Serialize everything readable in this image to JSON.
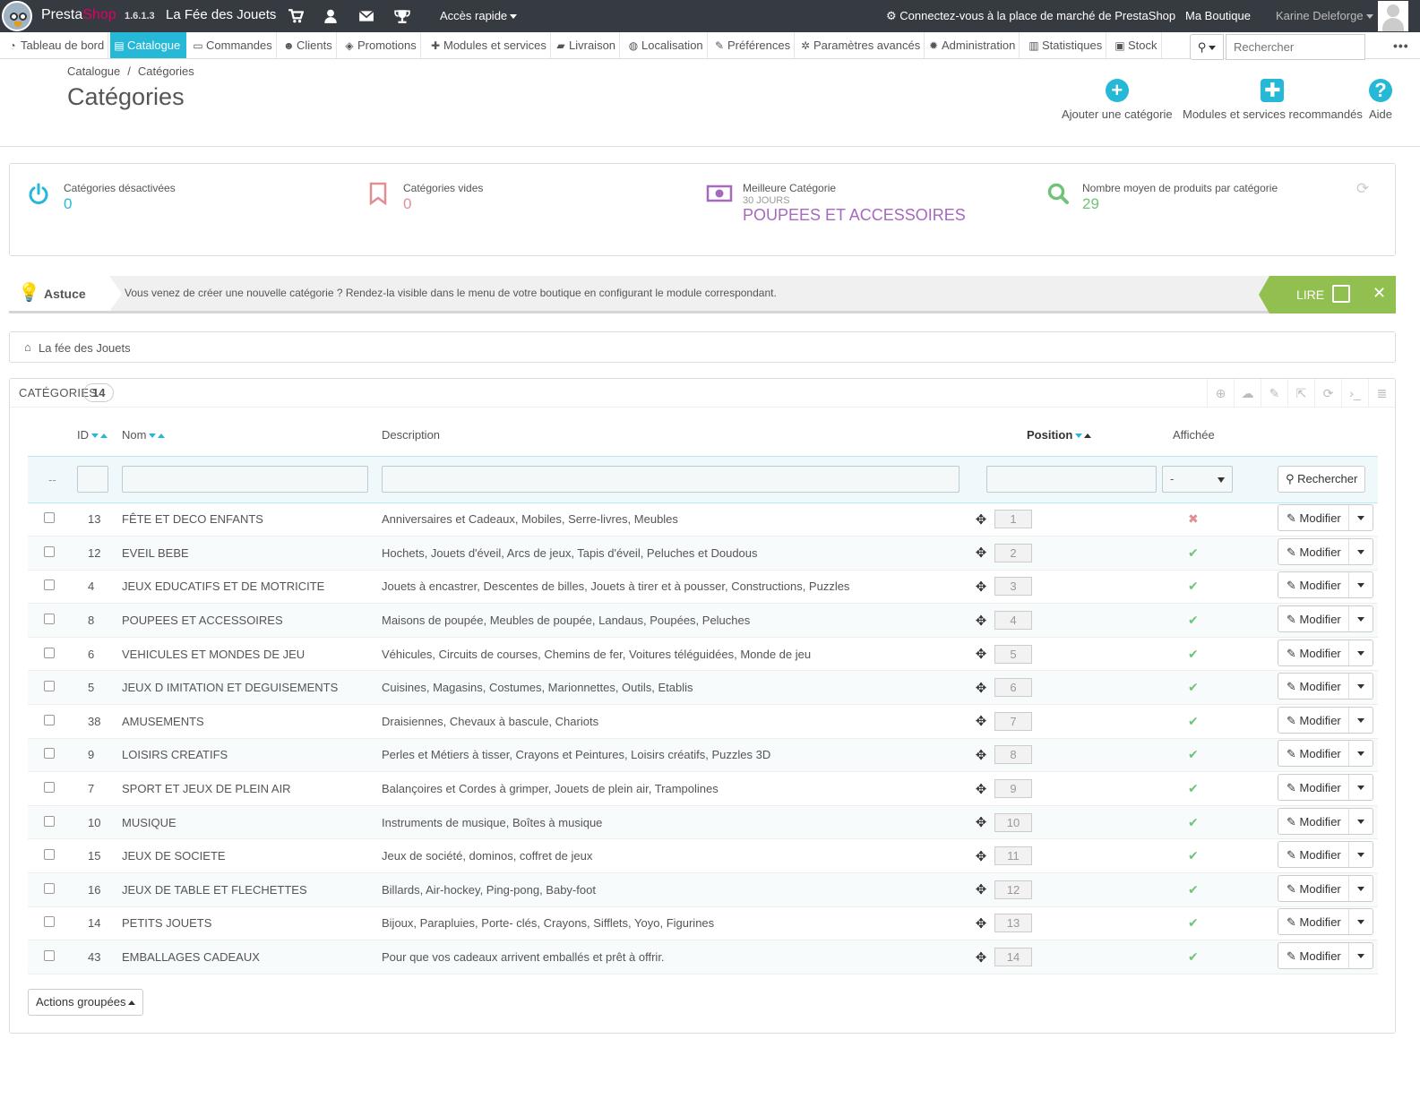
{
  "topbar": {
    "brand_part1": "Presta",
    "brand_part2": "Shop",
    "version": "1.6.1.3",
    "shop_name": "La Fée des Jouets",
    "quick_access": "Accès rapide",
    "marketplace": "Connectez-vous à la place de marché de PrestaShop",
    "my_shop": "Ma Boutique",
    "user": "Karine Deleforge"
  },
  "nav": {
    "items": [
      {
        "label": "Tableau de bord",
        "icon": "dashboard-icon"
      },
      {
        "label": "Catalogue",
        "icon": "catalog-icon",
        "active": true
      },
      {
        "label": "Commandes",
        "icon": "orders-icon"
      },
      {
        "label": "Clients",
        "icon": "customers-icon"
      },
      {
        "label": "Promotions",
        "icon": "tag-icon"
      },
      {
        "label": "Modules et services",
        "icon": "puzzle-icon"
      },
      {
        "label": "Livraison",
        "icon": "truck-icon"
      },
      {
        "label": "Localisation",
        "icon": "globe-icon"
      },
      {
        "label": "Préférences",
        "icon": "wrench-icon"
      },
      {
        "label": "Paramètres avancés",
        "icon": "cogs-icon"
      },
      {
        "label": "Administration",
        "icon": "gear-icon"
      },
      {
        "label": "Statistiques",
        "icon": "bar-chart-icon"
      },
      {
        "label": "Stock",
        "icon": "archive-icon"
      }
    ],
    "search_placeholder": "Rechercher",
    "more": "•••"
  },
  "header": {
    "breadcrumb_parent": "Catalogue",
    "breadcrumb_sep": "/",
    "breadcrumb_current": "Catégories",
    "title": "Catégories",
    "toolbar": {
      "add_category": "Ajouter une catégorie",
      "recommended_modules": "Modules et services recommandés",
      "help": "Aide"
    }
  },
  "kpis": [
    {
      "label": "Catégories désactivées",
      "value": "0",
      "color": "#25b9d7",
      "icon": "power-icon"
    },
    {
      "label": "Catégories vides",
      "value": "0",
      "color": "#e08f95",
      "icon": "bookmark-icon"
    },
    {
      "label": "Meilleure Catégorie",
      "sub": "30 JOURS",
      "value": "POUPEES ET ACCESSOIRES",
      "color": "#a569bd",
      "icon": "money-icon"
    },
    {
      "label": "Nombre moyen de produits par catégorie",
      "value": "29",
      "color": "#72c279",
      "icon": "search-icon"
    }
  ],
  "tip": {
    "title": "Astuce",
    "text": "Vous venez de créer une nouvelle catégorie ? Rendez-la visible dans le menu de votre boutique en configurant le module correspondant.",
    "read": "LIRE"
  },
  "shop_breadcrumb": "La fée des Jouets",
  "list": {
    "title": "Catégories",
    "count": "14",
    "columns": {
      "id": "ID",
      "name": "Nom",
      "description": "Description",
      "position": "Position",
      "displayed": "Affichée"
    },
    "filter": {
      "bulk_placeholder": "--",
      "displayed_value": "-",
      "search_button": "Rechercher"
    },
    "edit_label": "Modifier",
    "rows": [
      {
        "id": "13",
        "name": "FÊTE ET DECO ENFANTS",
        "description": "Anniversaires et Cadeaux, Mobiles, Serre-livres, Meubles",
        "position": "1",
        "displayed": false
      },
      {
        "id": "12",
        "name": "EVEIL BEBE",
        "description": "Hochets, Jouets d'éveil, Arcs de jeux, Tapis d'éveil, Peluches et Doudous",
        "position": "2",
        "displayed": true
      },
      {
        "id": "4",
        "name": "JEUX EDUCATIFS ET DE MOTRICITE",
        "description": "Jouets à encastrer, Descentes de billes, Jouets à tirer et à pousser, Constructions, Puzzles",
        "position": "3",
        "displayed": true
      },
      {
        "id": "8",
        "name": "POUPEES ET ACCESSOIRES",
        "description": "Maisons de poupée, Meubles de poupée, Landaus, Poupées, Peluches",
        "position": "4",
        "displayed": true
      },
      {
        "id": "6",
        "name": "VEHICULES ET MONDES DE JEU",
        "description": "Véhicules, Circuits de courses, Chemins de fer, Voitures téléguidées, Monde de jeu",
        "position": "5",
        "displayed": true
      },
      {
        "id": "5",
        "name": "JEUX D IMITATION ET DEGUISEMENTS",
        "description": "Cuisines, Magasins, Costumes, Marionnettes, Outils, Etablis",
        "position": "6",
        "displayed": true
      },
      {
        "id": "38",
        "name": "AMUSEMENTS",
        "description": "Draisiennes, Chevaux à bascule, Chariots",
        "position": "7",
        "displayed": true
      },
      {
        "id": "9",
        "name": "LOISIRS CREATIFS",
        "description": "Perles et Métiers à tisser, Crayons et Peintures, Loisirs créatifs, Puzzles 3D",
        "position": "8",
        "displayed": true
      },
      {
        "id": "7",
        "name": "SPORT ET JEUX DE PLEIN AIR",
        "description": "Balançoires et Cordes à grimper, Jouets de plein air, Trampolines",
        "position": "9",
        "displayed": true
      },
      {
        "id": "10",
        "name": "MUSIQUE",
        "description": "Instruments de musique, Boîtes à musique",
        "position": "10",
        "displayed": true
      },
      {
        "id": "15",
        "name": "JEUX DE SOCIETE",
        "description": "Jeux de société, dominos, coffret de jeux",
        "position": "11",
        "displayed": true
      },
      {
        "id": "16",
        "name": "JEUX DE TABLE ET FLECHETTES",
        "description": "Billards, Air-hockey, Ping-pong, Baby-foot",
        "position": "12",
        "displayed": true
      },
      {
        "id": "14",
        "name": "PETITS JOUETS",
        "description": "Bijoux, Parapluies, Porte- clés, Crayons, Sifflets, Yoyo, Figurines",
        "position": "13",
        "displayed": true
      },
      {
        "id": "43",
        "name": "EMBALLAGES CADEAUX",
        "description": "Pour que vos cadeaux arrivent emballés et prêt à offrir.",
        "position": "14",
        "displayed": true
      }
    ],
    "bulk_actions": "Actions groupées"
  }
}
